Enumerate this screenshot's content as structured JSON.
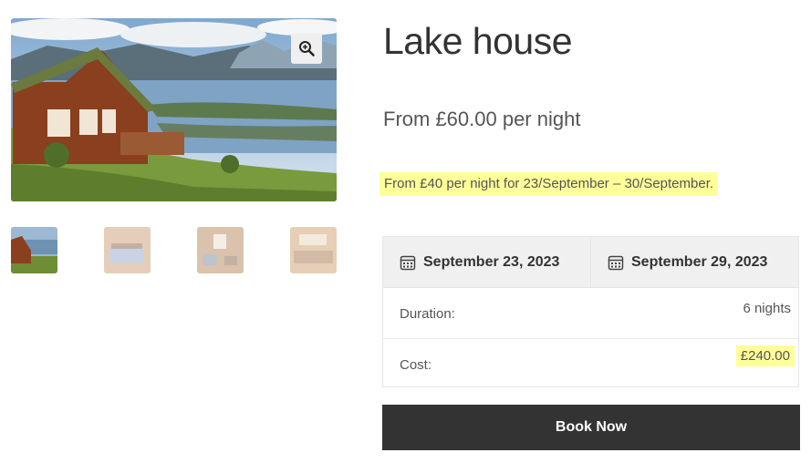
{
  "product": {
    "title": "Lake house",
    "price": "From £60.00 per night",
    "notice": "From £40 per night for 23/September – 30/September."
  },
  "gallery": {
    "main_image": "lake-house-cabin-photo",
    "zoom_icon": "zoom-in-icon",
    "thumbnails": [
      "lake-house-cabin",
      "bedroom",
      "living-room",
      "interior"
    ]
  },
  "booking": {
    "start_date": "September 23, 2023",
    "end_date": "September 29, 2023",
    "calendar_icon": "calendar-icon",
    "duration_label": "Duration:",
    "duration_value": "6 nights",
    "cost_label": "Cost:",
    "cost_value": "£240.00",
    "book_label": "Book Now"
  },
  "colors": {
    "highlight": "#ffff99",
    "button": "#333333"
  }
}
